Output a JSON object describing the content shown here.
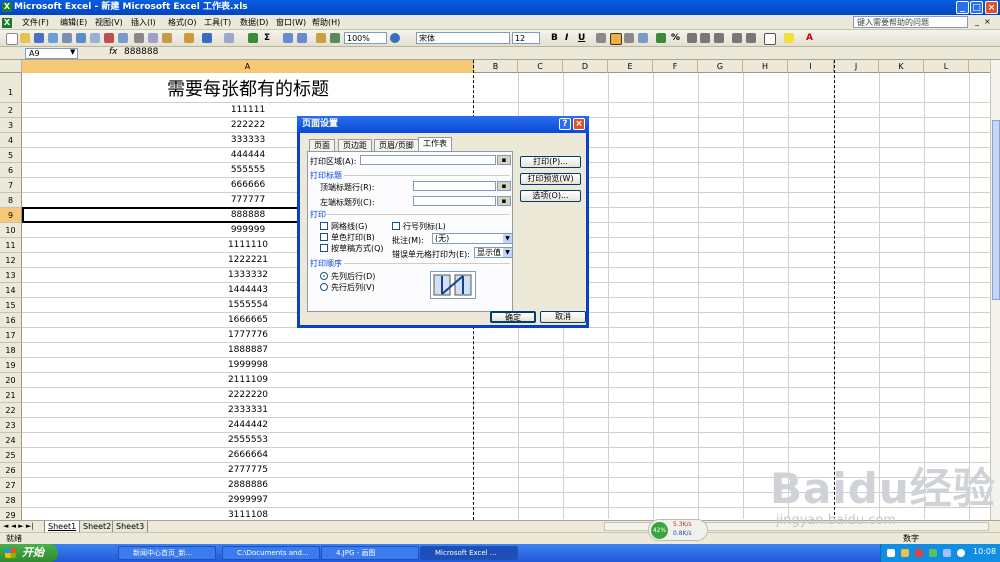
{
  "window": {
    "title": "Microsoft Excel - 新建 Microsoft Excel 工作表.xls"
  },
  "menu": {
    "items": [
      "文件(F)",
      "编辑(E)",
      "视图(V)",
      "插入(I)",
      "格式(O)",
      "工具(T)",
      "数据(D)",
      "窗口(W)",
      "帮助(H)"
    ],
    "help_placeholder": "键入需要帮助的问题"
  },
  "toolbar": {
    "zoom": "100%",
    "font": "宋体",
    "font_size": "12",
    "bold": "B",
    "italic": "I",
    "underline": "U"
  },
  "formula": {
    "name_box": "A9",
    "fx": "fx",
    "value": "888888"
  },
  "grid": {
    "columns": [
      "A",
      "B",
      "C",
      "D",
      "E",
      "F",
      "G",
      "H",
      "I",
      "J",
      "K",
      "L"
    ],
    "rows": [
      "1",
      "2",
      "3",
      "4",
      "5",
      "6",
      "7",
      "8",
      "9",
      "10",
      "11",
      "12",
      "13",
      "14",
      "15",
      "16",
      "17",
      "18",
      "19",
      "20",
      "21",
      "22",
      "23",
      "24",
      "25",
      "26",
      "27",
      "28",
      "29"
    ],
    "a1_title": "需要每张都有的标题",
    "a_values": [
      "111111",
      "222222",
      "333333",
      "444444",
      "555555",
      "666666",
      "777777",
      "888888",
      "999999",
      "1111110",
      "1222221",
      "1333332",
      "1444443",
      "1555554",
      "1666665",
      "1777776",
      "1888887",
      "1999998",
      "2111109",
      "2222220",
      "2333331",
      "2444442",
      "2555553",
      "2666664",
      "2777775",
      "2888886",
      "2999997",
      "3111108"
    ]
  },
  "sheets": {
    "tabs": [
      "Sheet1",
      "Sheet2",
      "Sheet3"
    ],
    "nav": "◄ ◄ ► ►|"
  },
  "status": {
    "left": "就绪",
    "right": "数字"
  },
  "dialog": {
    "title": "页面设置",
    "tabs": [
      "页面",
      "页边距",
      "页眉/页脚",
      "工作表"
    ],
    "print_area_label": "打印区域(A):",
    "print_titles_section": "打印标题",
    "top_rows_label": "顶端标题行(R):",
    "left_cols_label": "左端标题列(C):",
    "print_section": "打印",
    "gridlines_label": "网格线(G)",
    "bw_label": "单色打印(B)",
    "draft_label": "按草稿方式(Q)",
    "rowcol_label": "行号列标(L)",
    "comments_label": "批注(M):",
    "comments_value": "(无)",
    "errors_label": "错误单元格打印为(E):",
    "errors_value": "显示值",
    "order_section": "打印顺序",
    "order_down_label": "先列后行(D)",
    "order_over_label": "先行后列(V)",
    "buttons": {
      "print": "打印(P)...",
      "preview": "打印预览(W)",
      "options": "选项(O)...",
      "ok": "确定",
      "cancel": "取消"
    }
  },
  "taskbar": {
    "start": "开始",
    "items": [
      "新闻中心首页_新...",
      "C:\\Documents and...",
      "4.JPG - 画图",
      "Microsoft Excel ..."
    ],
    "clock": "10:08"
  },
  "network": {
    "pct": "42%",
    "up": "5.3K/s",
    "down": "0.8K/s"
  },
  "watermark": {
    "brand": "Baidu经验",
    "site": "jingyan.baidu.com"
  },
  "colors": {
    "titlebar": "#0a5ddf",
    "dialog_border": "#0a3fc8",
    "section_text": "#0046d5",
    "start": "#3d9c3f"
  }
}
